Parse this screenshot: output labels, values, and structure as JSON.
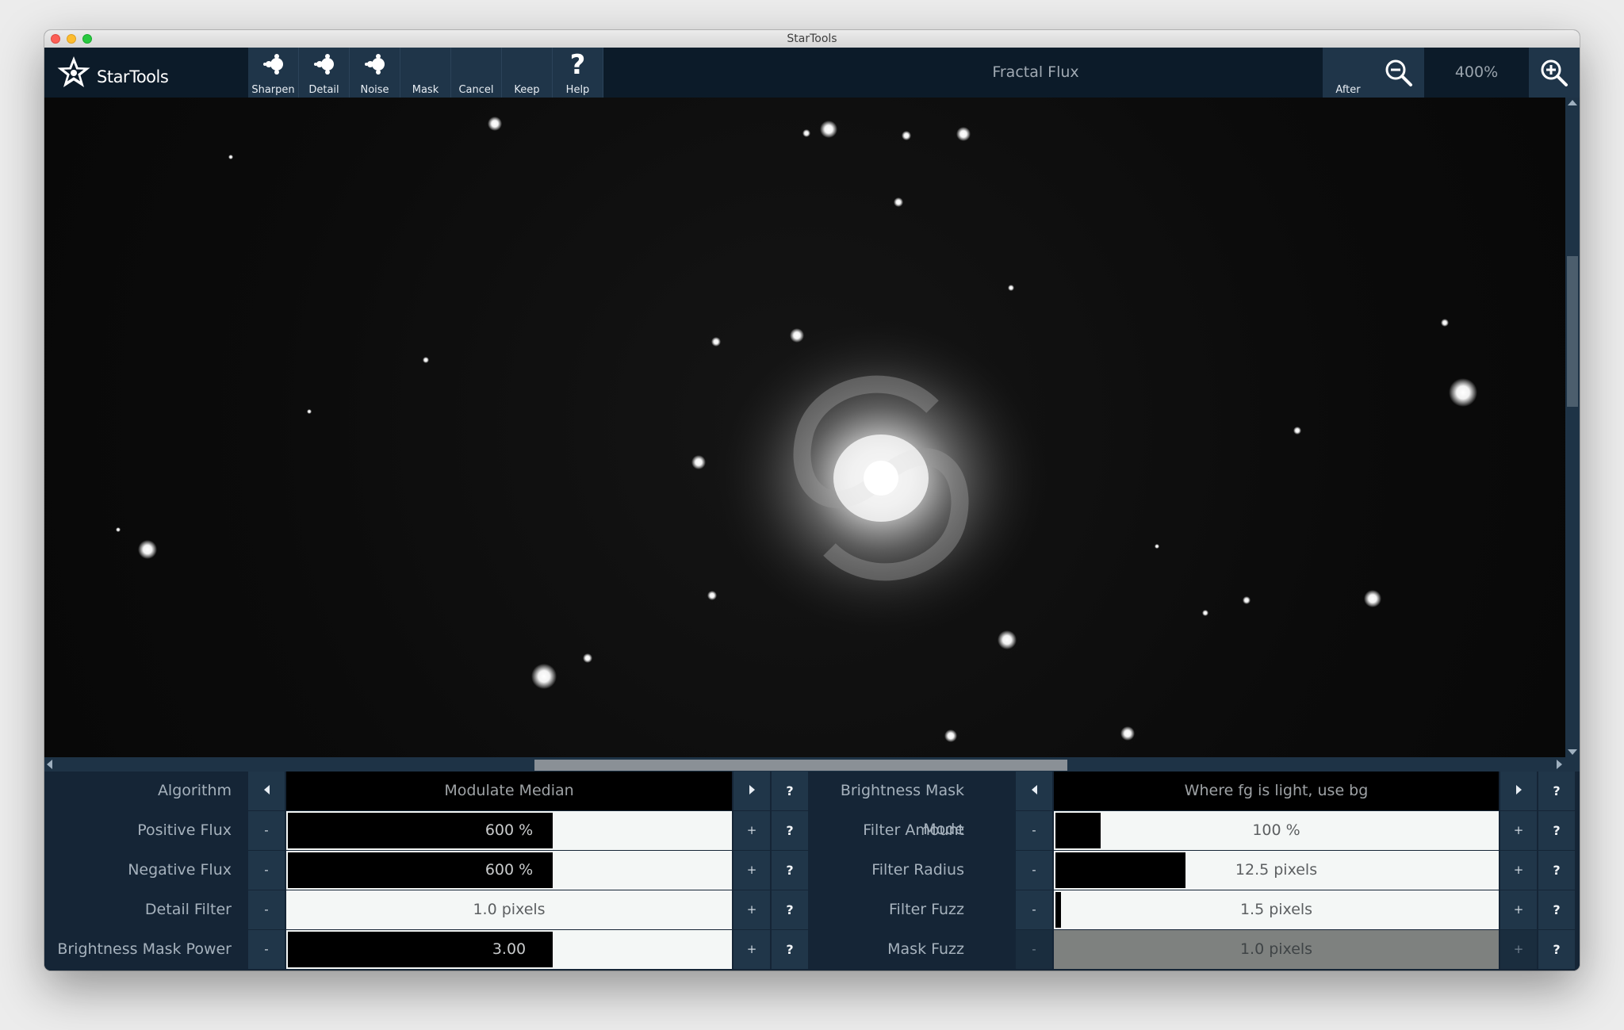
{
  "window": {
    "title": "StarTools"
  },
  "app": {
    "name": "StarTools",
    "logo_icon": "star-logo"
  },
  "toolbar": {
    "buttons": [
      {
        "label": "Sharpen",
        "icon": "fractal-icon"
      },
      {
        "label": "Detail",
        "icon": "fractal-icon"
      },
      {
        "label": "Noise",
        "icon": "fractal-icon"
      },
      {
        "label": "Mask",
        "icon": ""
      },
      {
        "label": "Cancel",
        "icon": ""
      },
      {
        "label": "Keep",
        "icon": ""
      },
      {
        "label": "Help",
        "icon": "question-icon"
      }
    ],
    "module_title": "Fractal Flux",
    "after_label": "After",
    "zoom_level": "400%"
  },
  "params_left": [
    {
      "label": "Algorithm",
      "value": "Modulate Median",
      "type": "select"
    },
    {
      "label": "Positive Flux",
      "value": "600 %",
      "type": "slider",
      "fill": 0.6
    },
    {
      "label": "Negative Flux",
      "value": "600 %",
      "type": "slider",
      "fill": 0.6
    },
    {
      "label": "Detail Filter",
      "value": "1.0 pixels",
      "type": "slider",
      "fill": 0
    },
    {
      "label": "Brightness Mask Power",
      "value": "3.00",
      "type": "slider",
      "fill": 0.6
    }
  ],
  "params_right": [
    {
      "label": "Brightness Mask Mode",
      "value": "Where fg is light, use bg",
      "type": "select"
    },
    {
      "label": "Filter Amount",
      "value": "100 %",
      "type": "slider",
      "fill": 0.1
    },
    {
      "label": "Filter Radius",
      "value": "12.5 pixels",
      "type": "slider",
      "fill": 0.29
    },
    {
      "label": "Filter Fuzz",
      "value": "1.5 pixels",
      "type": "slider",
      "fill": 0.01
    },
    {
      "label": "Mask Fuzz",
      "value": "1.0 pixels",
      "type": "slider-disabled",
      "fill": 0
    }
  ],
  "controls": {
    "decrement": "-",
    "increment": "+",
    "help": "?"
  },
  "colors": {
    "toolbar_bg": "#0c1b29",
    "button_bg": "#1f3549",
    "panel_bg": "#152536",
    "field_bg": "#f4f7f6"
  }
}
